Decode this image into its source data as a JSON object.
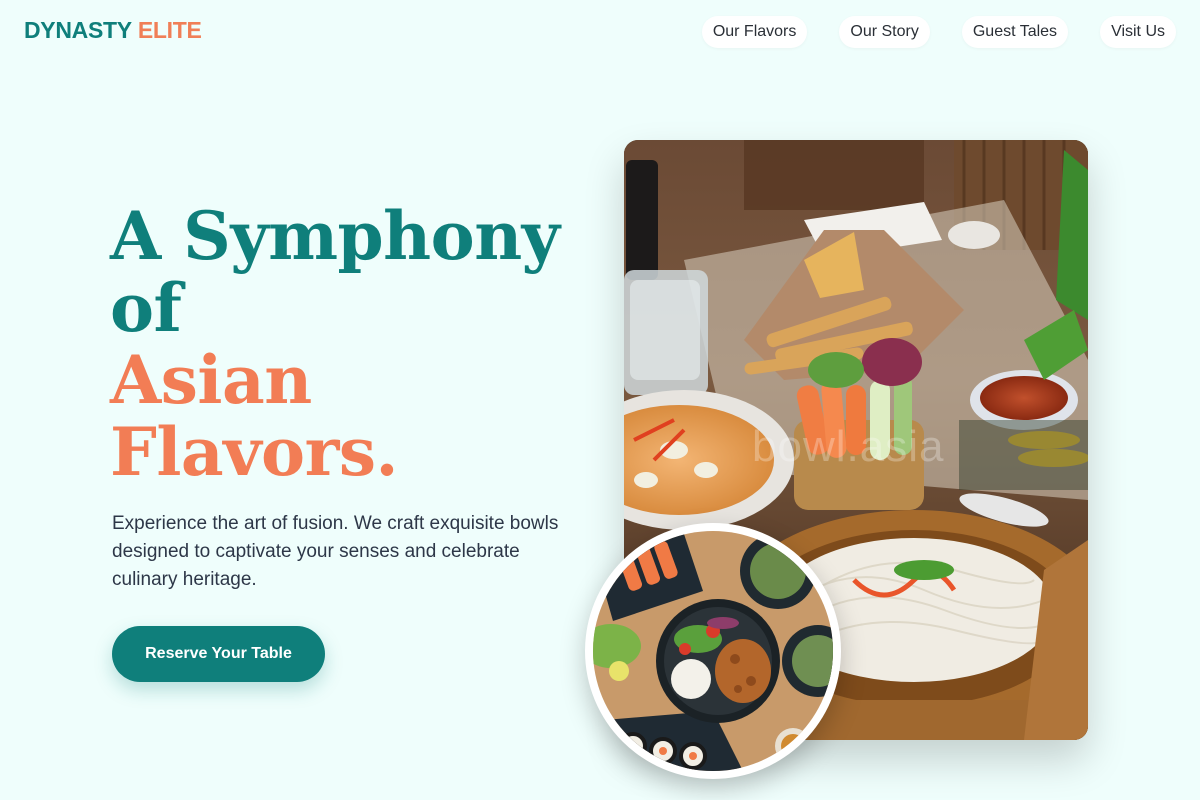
{
  "brand": {
    "part1": "DYNASTY",
    "part2": "ELITE",
    "color_primary": "#0f7f7b",
    "color_accent": "#f07f57"
  },
  "nav": {
    "items": [
      {
        "label": "Our Flavors"
      },
      {
        "label": "Our Story"
      },
      {
        "label": "Guest Tales"
      },
      {
        "label": "Visit Us"
      }
    ]
  },
  "hero": {
    "headline": {
      "line1": "A Symphony",
      "line2": "of",
      "line3": "Asian",
      "line4": "Flavors."
    },
    "subtext": "Experience the art of fusion. We craft exquisite bowls designed to captivate your senses and celebrate culinary heritage.",
    "cta_label": "Reserve Your Table"
  },
  "images": {
    "main_watermark": "bowl.asia"
  }
}
